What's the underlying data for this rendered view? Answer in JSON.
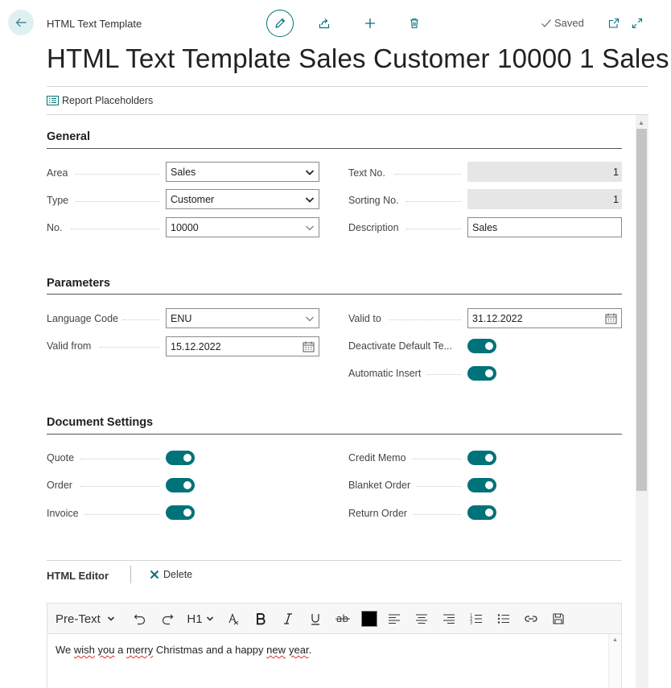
{
  "header": {
    "breadcrumb": "HTML Text Template",
    "title": "HTML Text Template Sales Customer 10000 1 Sales",
    "saved_label": "Saved"
  },
  "actions": {
    "report_placeholders": "Report Placeholders"
  },
  "general": {
    "title": "General",
    "area": {
      "label": "Area",
      "value": "Sales"
    },
    "type": {
      "label": "Type",
      "value": "Customer"
    },
    "no": {
      "label": "No.",
      "value": "10000"
    },
    "text_no": {
      "label": "Text No.",
      "value": "1"
    },
    "sorting_no": {
      "label": "Sorting No.",
      "value": "1"
    },
    "description": {
      "label": "Description",
      "value": "Sales"
    }
  },
  "parameters": {
    "title": "Parameters",
    "language_code": {
      "label": "Language Code",
      "value": "ENU"
    },
    "valid_from": {
      "label": "Valid from",
      "value": "15.12.2022"
    },
    "valid_to": {
      "label": "Valid to",
      "value": "31.12.2022"
    },
    "deactivate_default": {
      "label": "Deactivate Default Te...",
      "on": true
    },
    "automatic_insert": {
      "label": "Automatic Insert",
      "on": true
    }
  },
  "document_settings": {
    "title": "Document Settings",
    "quote": {
      "label": "Quote",
      "on": true
    },
    "order": {
      "label": "Order",
      "on": true
    },
    "invoice": {
      "label": "Invoice",
      "on": true
    },
    "credit_memo": {
      "label": "Credit Memo",
      "on": true
    },
    "blanket_order": {
      "label": "Blanket Order",
      "on": true
    },
    "return_order": {
      "label": "Return Order",
      "on": true
    }
  },
  "html_editor": {
    "title": "HTML Editor",
    "delete_label": "Delete",
    "format_select": "Pre-Text",
    "heading_select": "H1",
    "body_words": [
      "We",
      "wish",
      "you",
      "a",
      "merry",
      "Christmas and a happy",
      "new",
      "year",
      "."
    ]
  },
  "colors": {
    "accent": "#00727a",
    "font_color_swatch": "#000000"
  }
}
